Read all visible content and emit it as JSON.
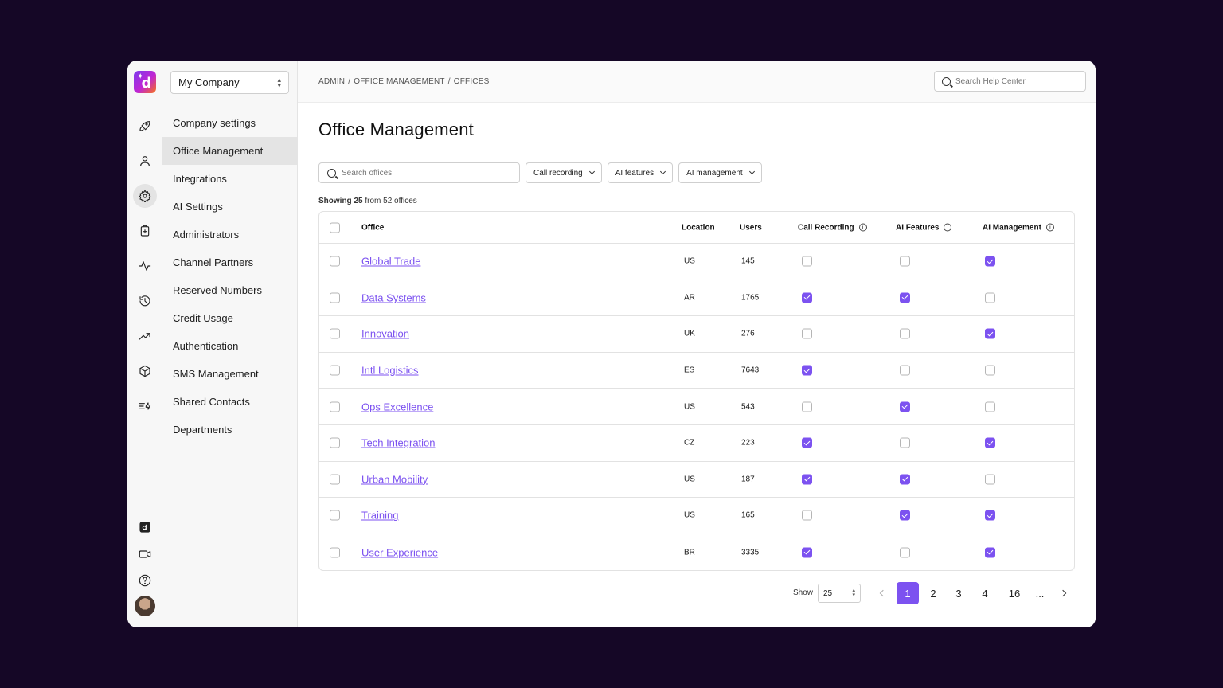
{
  "company_selector": {
    "value": "My Company"
  },
  "sidebar": {
    "items": [
      {
        "label": "Company settings",
        "active": false
      },
      {
        "label": "Office Management",
        "active": true
      },
      {
        "label": "Integrations",
        "active": false
      },
      {
        "label": "AI Settings",
        "active": false
      },
      {
        "label": "Administrators",
        "active": false
      },
      {
        "label": "Channel Partners",
        "active": false
      },
      {
        "label": "Reserved Numbers",
        "active": false
      },
      {
        "label": "Credit Usage",
        "active": false
      },
      {
        "label": "Authentication",
        "active": false
      },
      {
        "label": "SMS Management",
        "active": false
      },
      {
        "label": "Shared Contacts",
        "active": false
      },
      {
        "label": "Departments",
        "active": false
      }
    ]
  },
  "rail": {
    "icons": [
      "rocket-icon",
      "user-icon",
      "gear-icon",
      "clipboard-icon",
      "activity-icon",
      "history-icon",
      "trending-icon",
      "box-icon",
      "routing-icon",
      "brand-icon",
      "video-icon",
      "help-icon"
    ]
  },
  "breadcrumb": {
    "items": [
      "ADMIN",
      "OFFICE MANAGEMENT",
      "OFFICES"
    ],
    "separator": "/"
  },
  "help_search": {
    "placeholder": "Search Help Center"
  },
  "page_title": "Office Management",
  "filters": {
    "search_placeholder": "Search offices",
    "dropdowns": [
      "Call recording",
      "AI features",
      "AI management"
    ]
  },
  "showing": {
    "prefix": "Showing",
    "count": "25",
    "suffix": "from 52 offices"
  },
  "table": {
    "headers": {
      "office": "Office",
      "location": "Location",
      "users": "Users",
      "call_recording": "Call Recording",
      "ai_features": "AI Features",
      "ai_management": "AI Management"
    },
    "rows": [
      {
        "office": "Global Trade",
        "location": "US",
        "users": "145",
        "call_recording": false,
        "ai_features": false,
        "ai_management": true
      },
      {
        "office": "Data Systems",
        "location": "AR",
        "users": "1765",
        "call_recording": true,
        "ai_features": true,
        "ai_management": false
      },
      {
        "office": "Innovation",
        "location": "UK",
        "users": "276",
        "call_recording": false,
        "ai_features": false,
        "ai_management": true
      },
      {
        "office": "Intl Logistics",
        "location": "ES",
        "users": "7643",
        "call_recording": true,
        "ai_features": false,
        "ai_management": false
      },
      {
        "office": "Ops Excellence",
        "location": "US",
        "users": "543",
        "call_recording": false,
        "ai_features": true,
        "ai_management": false
      },
      {
        "office": "Tech Integration",
        "location": "CZ",
        "users": "223",
        "call_recording": true,
        "ai_features": false,
        "ai_management": true
      },
      {
        "office": "Urban Mobility",
        "location": "US",
        "users": "187",
        "call_recording": true,
        "ai_features": true,
        "ai_management": false
      },
      {
        "office": "Training",
        "location": "US",
        "users": "165",
        "call_recording": false,
        "ai_features": true,
        "ai_management": true
      },
      {
        "office": "User Experience",
        "location": "BR",
        "users": "3335",
        "call_recording": true,
        "ai_features": false,
        "ai_management": true
      }
    ]
  },
  "pagination": {
    "show_label": "Show",
    "page_size": "25",
    "pages": [
      "1",
      "2",
      "3",
      "4",
      "16"
    ],
    "ellipsis": "...",
    "current": "1"
  },
  "colors": {
    "accent": "#7c52f0",
    "background": "#150726"
  }
}
